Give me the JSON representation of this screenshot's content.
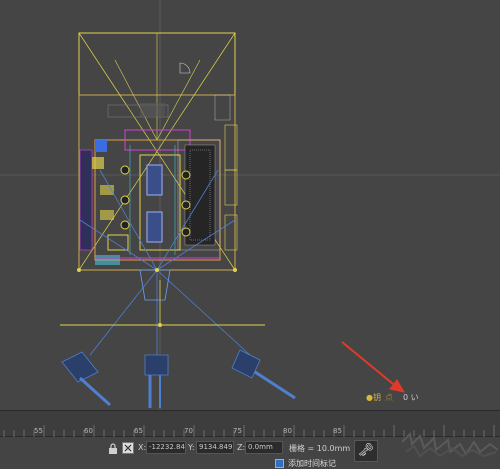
{
  "viewport": {
    "hint": {
      "label_a": "●钥",
      "label_b": "点",
      "value": "0 い"
    }
  },
  "timeline": {
    "tick_labels": [
      "55",
      "60",
      "65",
      "70",
      "75",
      "80",
      "85"
    ]
  },
  "statusbar": {
    "x_label": "X:",
    "x_value": "-12232.84",
    "y_label": "Y:",
    "y_value": "9134.849",
    "z_label": "Z:",
    "z_value": "0.0mm",
    "grid_text": "栅格 = 10.0mm",
    "add_time_tag": "添加时间标记",
    "key_icon": "key-icon"
  },
  "colors": {
    "viewport_bg": "#454545",
    "wire_yellow": "#e0d24a",
    "camera_blue": "#4f7fd0",
    "arrow_red": "#e03a2a"
  }
}
